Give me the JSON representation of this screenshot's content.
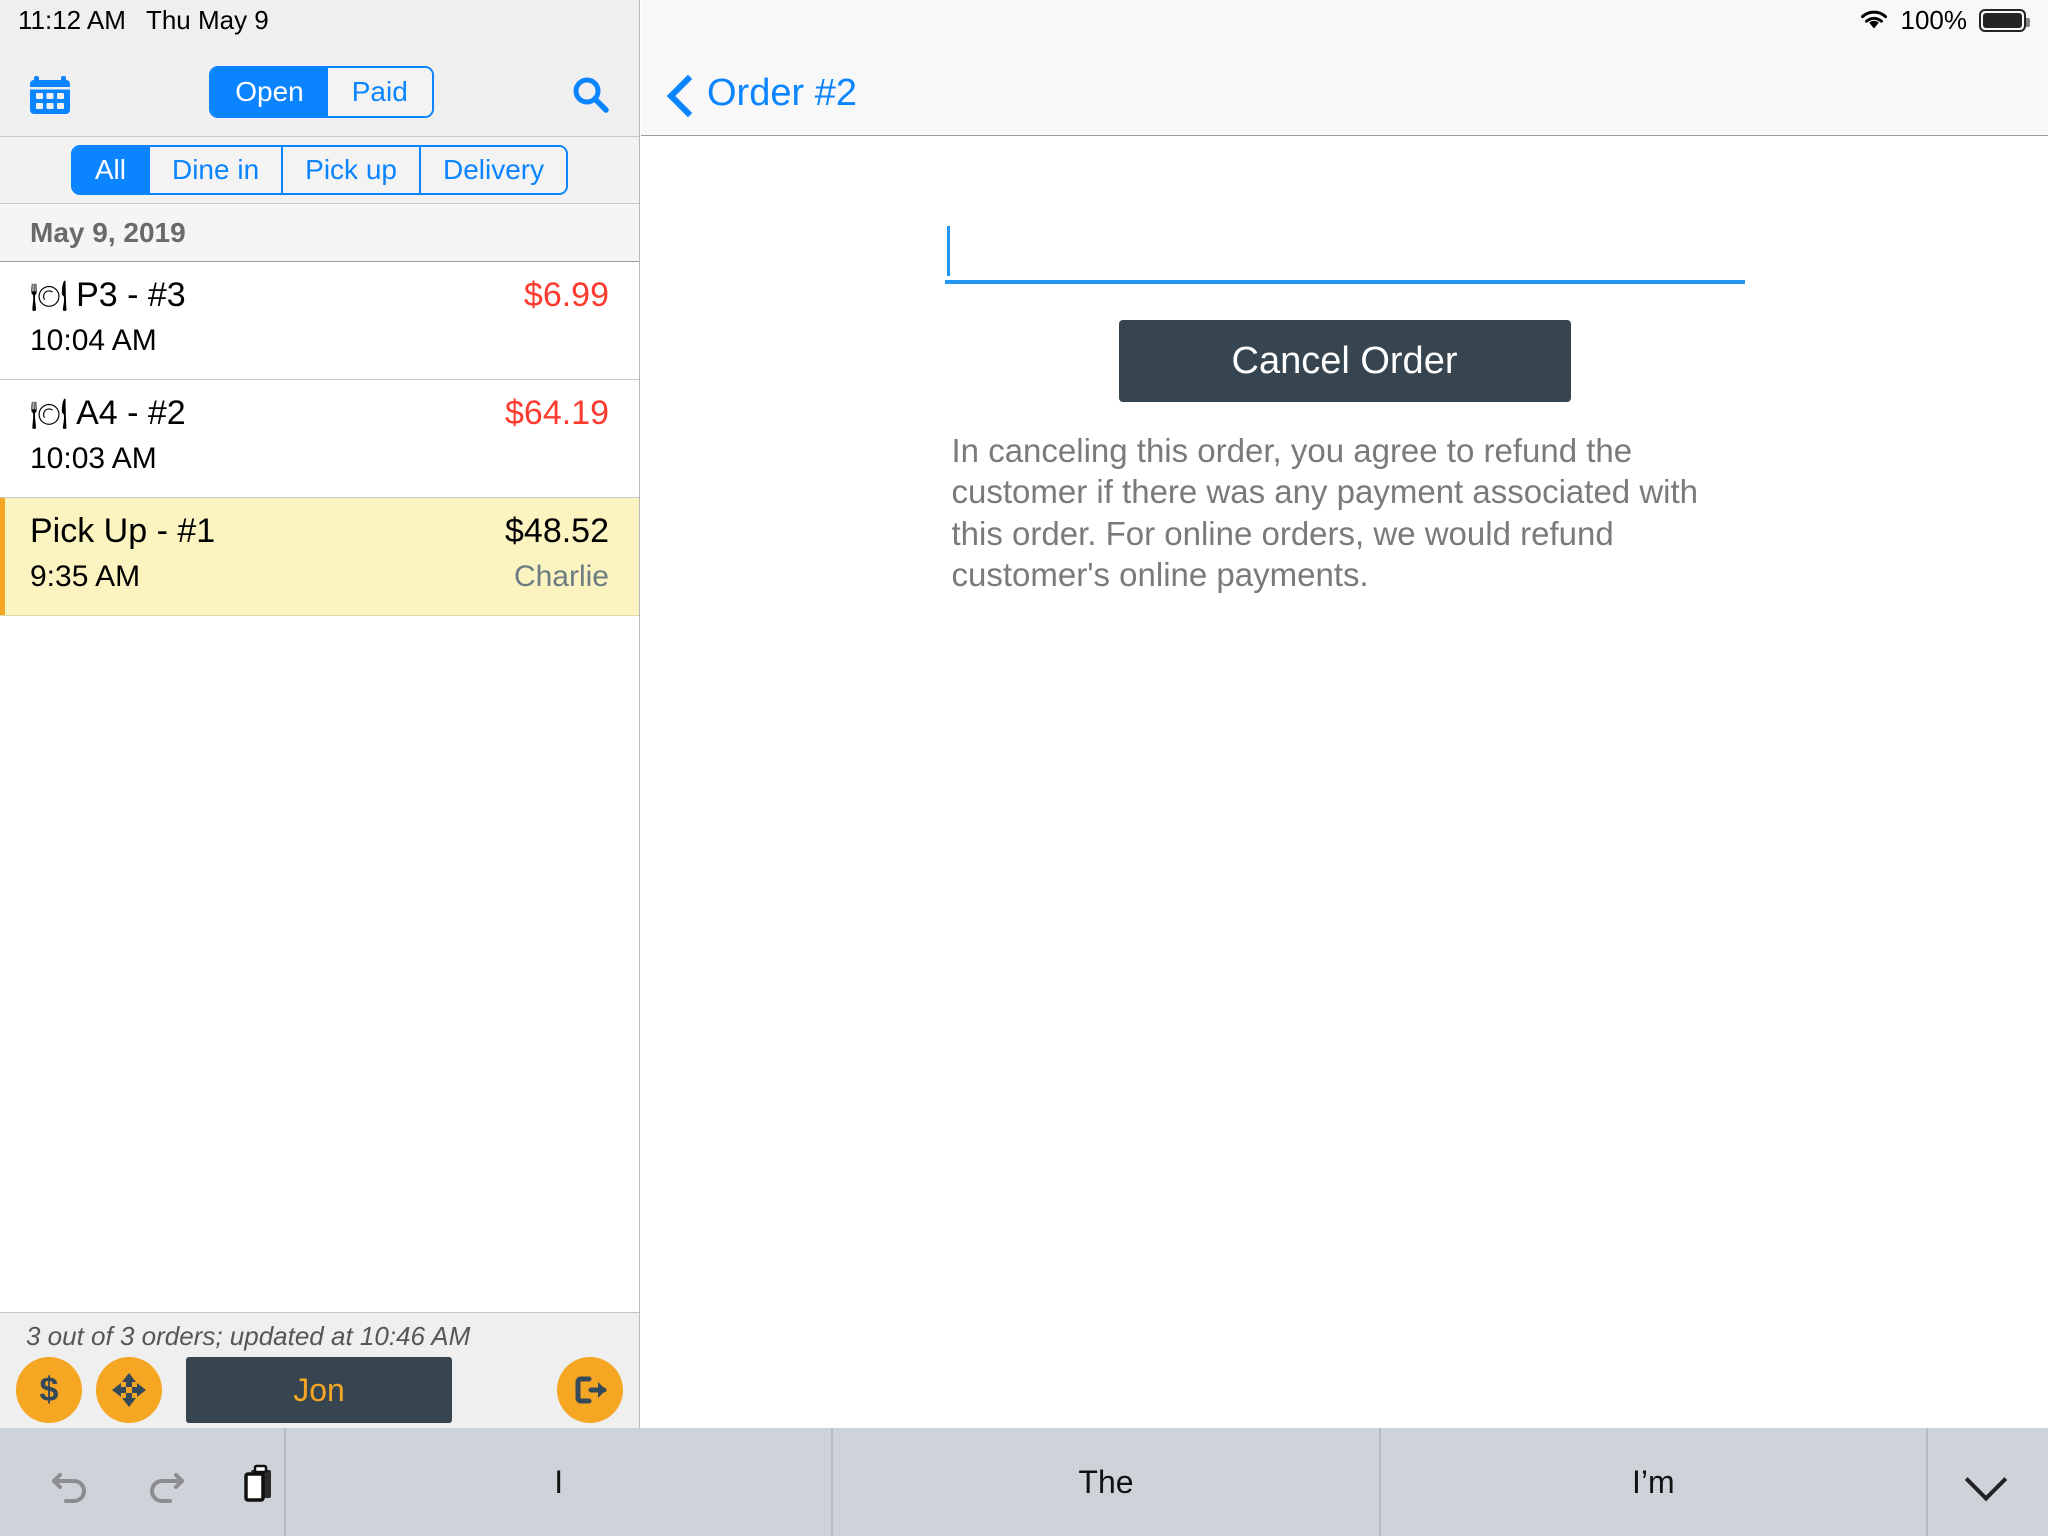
{
  "status_bar": {
    "time": "11:12 AM",
    "date": "Thu May 9",
    "wifi_icon": "wifi-icon",
    "battery_percent": "100%",
    "battery_icon": "battery-full-icon"
  },
  "sidebar": {
    "calendar_icon": "calendar-icon",
    "search_icon": "search-icon",
    "status_segment": {
      "options": [
        "Open",
        "Paid"
      ],
      "selected": "Open"
    },
    "type_segment": {
      "options": [
        "All",
        "Dine in",
        "Pick up",
        "Delivery"
      ],
      "selected": "All"
    },
    "date_header": "May 9, 2019",
    "orders": [
      {
        "emoji": "🍽",
        "title": "P3 - #3",
        "time": "10:04 AM",
        "price": "$6.99",
        "server": "",
        "selected": false
      },
      {
        "emoji": "🍽",
        "title": "A4 - #2",
        "time": "10:03 AM",
        "price": "$64.19",
        "server": "",
        "selected": false
      },
      {
        "emoji": "",
        "title": "Pick Up - #1",
        "time": "9:35 AM",
        "price": "$48.52",
        "server": "Charlie",
        "selected": true
      }
    ],
    "footer": {
      "status_text": "3 out of 3 orders; updated at 10:46 AM",
      "cash_icon": "dollar-icon",
      "move_icon": "move-arrows-icon",
      "user_label": "Jon",
      "logout_icon": "logout-icon"
    }
  },
  "main": {
    "back_label": "Order #2",
    "back_icon": "chevron-left-icon",
    "reason_input_value": "",
    "reason_input_placeholder": "",
    "cancel_button_label": "Cancel Order",
    "disclaimer": "In canceling this order, you agree to refund the customer if there was any payment associated with this order. For online orders, we would refund customer's online payments."
  },
  "keyboard_bar": {
    "undo_icon": "undo-icon",
    "redo_icon": "redo-icon",
    "paste_icon": "paste-icon",
    "suggestions": [
      "I",
      "The",
      "I’m"
    ],
    "dismiss_icon": "chevron-down-icon"
  },
  "colors": {
    "accent_blue": "#0a84ff",
    "price_red": "#ff3b30",
    "selected_row_yellow": "#fbf4c0",
    "brand_orange": "#f5a623",
    "dark_slate": "#36454f"
  }
}
